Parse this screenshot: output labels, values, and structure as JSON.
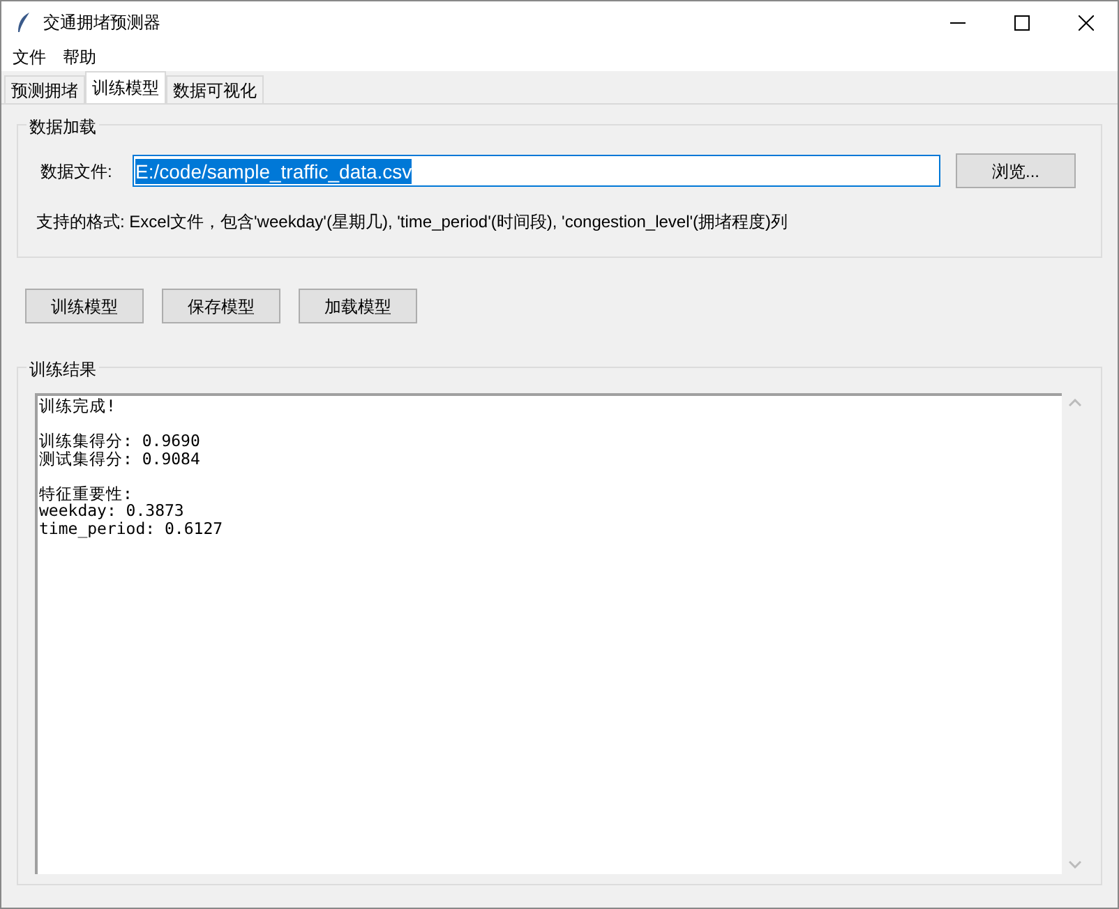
{
  "window": {
    "title": "交通拥堵预测器"
  },
  "menu": [
    "文件",
    "帮助"
  ],
  "tabs": [
    {
      "label": "预测拥堵",
      "selected": false
    },
    {
      "label": "训练模型",
      "selected": true
    },
    {
      "label": "数据可视化",
      "selected": false
    }
  ],
  "data_loading": {
    "title": "数据加载",
    "file_label": "数据文件:",
    "file_value": "E:/code/sample_traffic_data.csv",
    "browse_button": "浏览...",
    "hint": "支持的格式: Excel文件，包含'weekday'(星期几), 'time_period'(时间段), 'congestion_level'(拥堵程度)列"
  },
  "actions": [
    "训练模型",
    "保存模型",
    "加载模型"
  ],
  "results": {
    "title": "训练结果",
    "paragraphs": [
      [
        "训练完成!"
      ],
      [
        "训练集得分: 0.9690",
        "测试集得分: 0.9084"
      ],
      [
        "特征重要性:",
        "weekday: 0.3873",
        "time_period: 0.6127"
      ]
    ]
  }
}
